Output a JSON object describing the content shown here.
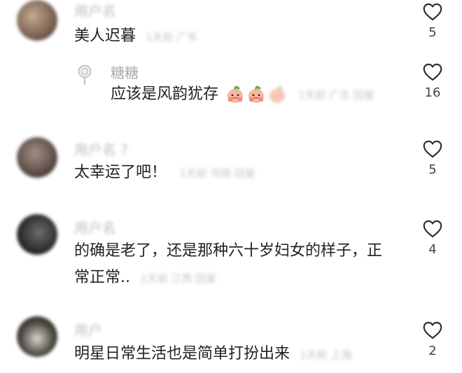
{
  "comments": [
    {
      "username": "用户名",
      "text": "美人迟暮",
      "meta": "1天前 广东",
      "likes": "5"
    },
    {
      "username": "糖糖",
      "text": "应该是风韵犹存",
      "meta": "1天前 广东 回复",
      "likes": "16"
    },
    {
      "username": "用户名 ?",
      "text": "太幸运了吧！",
      "meta": "1天前 河南 回复",
      "likes": "5"
    },
    {
      "username": "用户名",
      "text_line1": "的确是老了，还是那种六十岁妇女的样子，正",
      "text_line2": "常正常..",
      "meta": "1天前 江西 回复",
      "likes": "4"
    },
    {
      "username": "用户",
      "text": "明星日常生活也是简单打扮出来",
      "meta": "1天前 上海",
      "likes": "2"
    }
  ],
  "icons": {
    "like": "heart-outline-icon",
    "reply_avatar": "lollipop-icon",
    "emoji": "peach-face-emoji"
  },
  "colors": {
    "text": "#222222",
    "muted": "#a9aab0",
    "background": "#ffffff"
  }
}
